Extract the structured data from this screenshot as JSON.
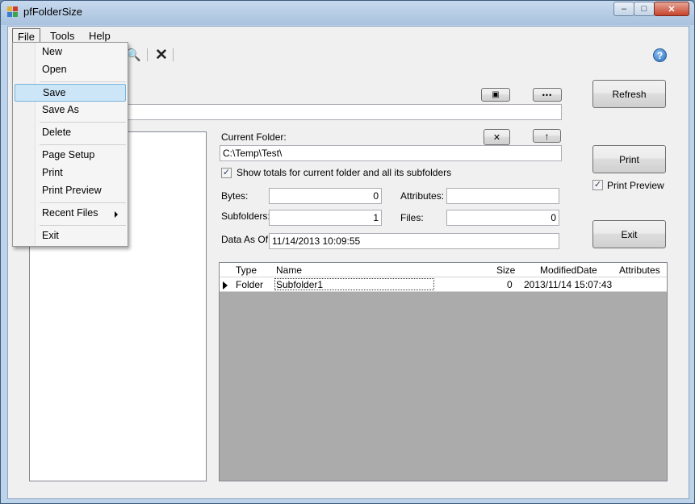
{
  "window": {
    "title": "pfFolderSize",
    "minimize": "–",
    "maximize": "□",
    "close": "✕"
  },
  "menu": {
    "file": "File",
    "tools": "Tools",
    "help": "Help"
  },
  "file_menu": {
    "new": "New",
    "open": "Open",
    "save": "Save",
    "save_as": "Save As",
    "delete": "Delete",
    "page_setup": "Page Setup",
    "print": "Print",
    "print_preview": "Print Preview",
    "recent_files": "Recent Files",
    "exit": "Exit"
  },
  "toolbar": {
    "delete_glyph": "✕",
    "preview_glyph": "🔍",
    "help_glyph": "?"
  },
  "top": {
    "save_glyph": "▣",
    "browse_glyph": "•••",
    "path_value": "",
    "refresh_label": "Refresh"
  },
  "folder": {
    "current_label": "Current Folder:",
    "clear_glyph": "✕",
    "up_glyph": "↑",
    "current_value": "C:\\Temp\\Test\\",
    "totals_label": "Show totals for current folder and all its subfolders",
    "totals_checked": true,
    "bytes_label": "Bytes:",
    "bytes_value": "0",
    "attributes_label": "Attributes:",
    "attributes_value": "",
    "subfolders_label": "Subfolders:",
    "subfolders_value": "1",
    "files_label": "Files:",
    "files_value": "0",
    "data_as_of_label": "Data As Of:",
    "data_as_of_value": "11/14/2013 10:09:55"
  },
  "side": {
    "print_label": "Print",
    "print_preview_label": "Print Preview",
    "print_preview_checked": true,
    "exit_label": "Exit",
    "check_glyph": "✓"
  },
  "grid": {
    "columns": [
      "Type",
      "Name",
      "Size",
      "ModifiedDate",
      "Attributes"
    ],
    "rows": [
      {
        "type": "Folder",
        "name": "Subfolder1",
        "size": "0",
        "modified": "2013/11/14 15:07:43",
        "attributes": ""
      }
    ]
  }
}
